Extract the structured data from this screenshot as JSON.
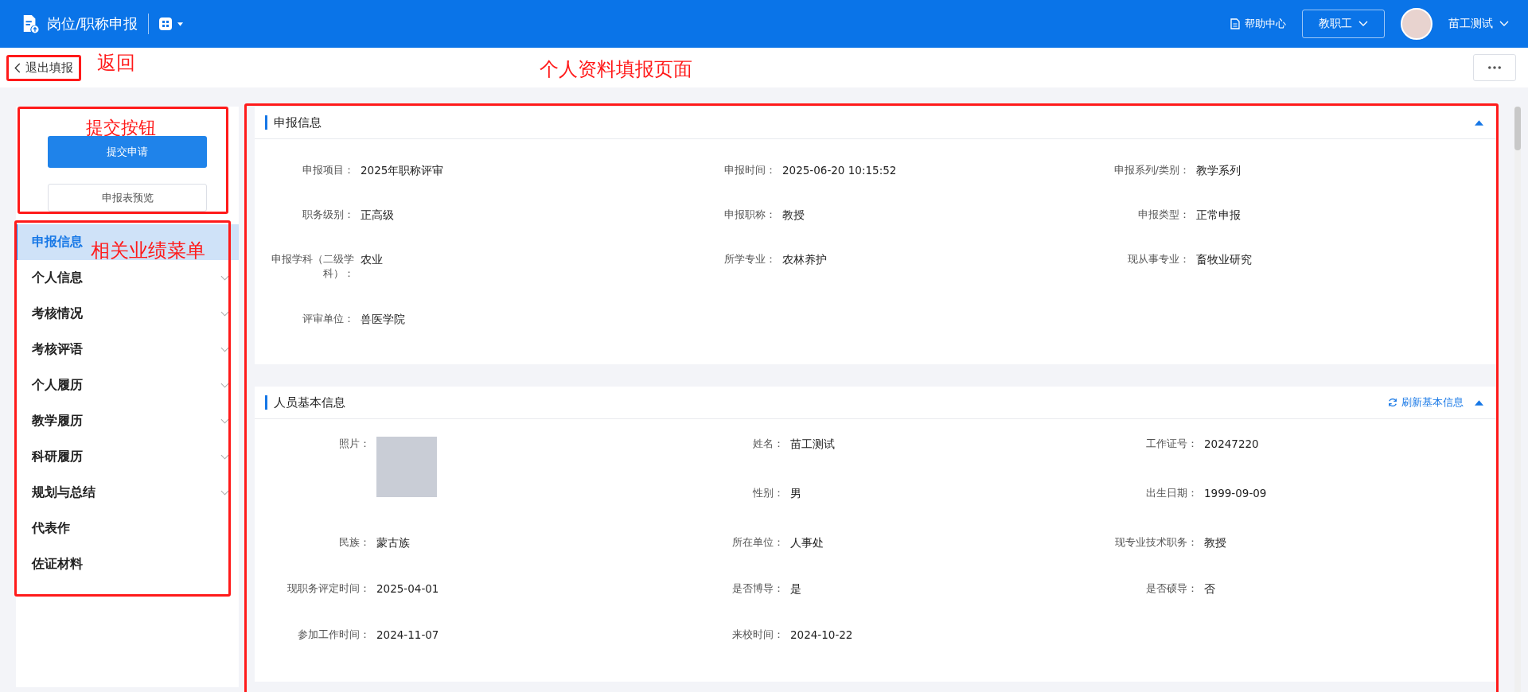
{
  "header": {
    "title": "岗位/职称申报",
    "help": "帮助中心",
    "role": "教职工",
    "user": "苗工测试"
  },
  "toolbar": {
    "back": "退出填报"
  },
  "sidebar": {
    "submit": "提交申请",
    "preview": "申报表预览",
    "items": [
      {
        "label": "申报信息",
        "selected": true,
        "expandable": false
      },
      {
        "label": "个人信息",
        "selected": false,
        "expandable": true
      },
      {
        "label": "考核情况",
        "selected": false,
        "expandable": true
      },
      {
        "label": "考核评语",
        "selected": false,
        "expandable": true
      },
      {
        "label": "个人履历",
        "selected": false,
        "expandable": true
      },
      {
        "label": "教学履历",
        "selected": false,
        "expandable": true
      },
      {
        "label": "科研履历",
        "selected": false,
        "expandable": true
      },
      {
        "label": "规划与总结",
        "selected": false,
        "expandable": true
      },
      {
        "label": "代表作",
        "selected": false,
        "expandable": false
      },
      {
        "label": "佐证材料",
        "selected": false,
        "expandable": false
      }
    ]
  },
  "sections": [
    {
      "title": "申报信息",
      "expanded": true,
      "fields": [
        {
          "kind": "text",
          "label": "申报项目：",
          "value": "2025年职称评审"
        },
        {
          "kind": "text",
          "label": "申报时间：",
          "value": "2025-06-20 10:15:52"
        },
        {
          "kind": "text",
          "label": "申报系列/类别：",
          "value": "教学系列"
        },
        {
          "kind": "text",
          "label": "职务级别：",
          "value": "正高级"
        },
        {
          "kind": "text",
          "label": "申报职称：",
          "value": "教授"
        },
        {
          "kind": "text",
          "label": "申报类型：",
          "value": "正常申报"
        },
        {
          "kind": "text",
          "label": "申报学科（二级学科）：",
          "value": "农业"
        },
        {
          "kind": "text",
          "label": "所学专业：",
          "value": "农林养护"
        },
        {
          "kind": "text",
          "label": "现从事专业：",
          "value": "畜牧业研究"
        },
        {
          "kind": "text",
          "label": "评审单位：",
          "value": "兽医学院"
        }
      ]
    },
    {
      "title": "人员基本信息",
      "expanded": true,
      "action": "刷新基本信息",
      "fields": [
        {
          "kind": "photo",
          "label": "照片："
        },
        {
          "kind": "text",
          "label": "姓名：",
          "value": "苗工测试"
        },
        {
          "kind": "text",
          "label": "工作证号：",
          "value": "20247220"
        },
        {
          "kind": "text",
          "label": "性别：",
          "value": "男"
        },
        {
          "kind": "text",
          "label": "出生日期：",
          "value": "1999-09-09"
        },
        {
          "kind": "text",
          "label": "民族：",
          "value": "蒙古族"
        },
        {
          "kind": "text",
          "label": "所在单位：",
          "value": "人事处"
        },
        {
          "kind": "text",
          "label": "现专业技术职务：",
          "value": "教授"
        },
        {
          "kind": "text",
          "label": "现职务评定时间：",
          "value": "2025-04-01"
        },
        {
          "kind": "text",
          "label": "是否博导：",
          "value": "是"
        },
        {
          "kind": "text",
          "label": "是否硕导：",
          "value": "否"
        },
        {
          "kind": "text",
          "label": "参加工作时间：",
          "value": "2024-11-07"
        },
        {
          "kind": "text",
          "label": "来校时间：",
          "value": "2024-10-22"
        }
      ]
    }
  ],
  "annotations": {
    "back": "返回",
    "submit": "提交按钮",
    "menu": "相关业绩菜单",
    "page": "个人资料填报页面"
  }
}
